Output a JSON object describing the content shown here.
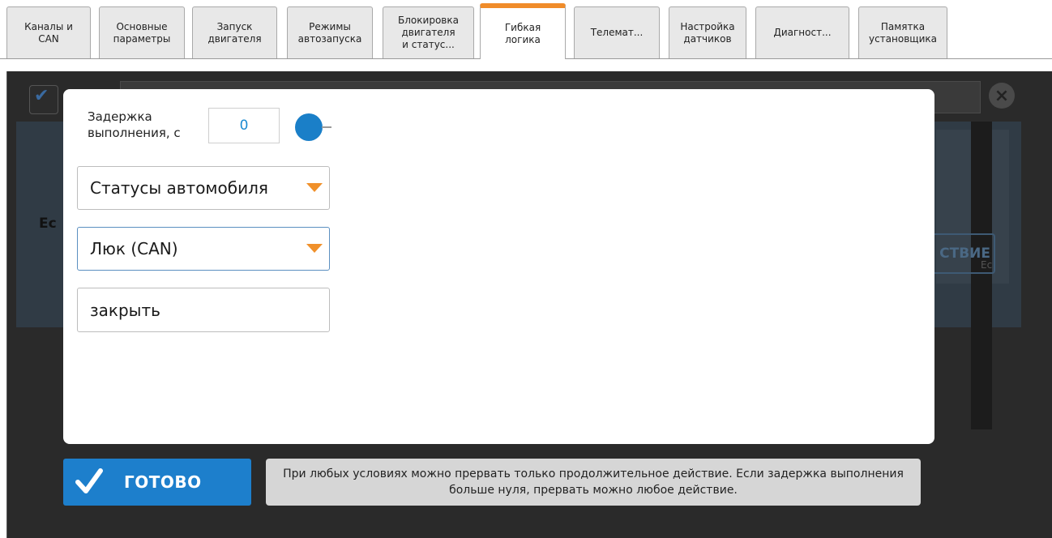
{
  "tabs": [
    {
      "label": "Каналы и\nCAN"
    },
    {
      "label": "Основные\nпараметры"
    },
    {
      "label": "Запуск\nдвигателя"
    },
    {
      "label": "Режимы\nавтозапуска"
    },
    {
      "label": "Блокировка\nдвигателя\nи статус..."
    },
    {
      "label": "Гибкая\nлогика"
    },
    {
      "label": "Телемат..."
    },
    {
      "label": "Настройка\nдатчиков"
    },
    {
      "label": "Диагност..."
    },
    {
      "label": "Памятка\nустановщика"
    }
  ],
  "active_tab_index": 5,
  "background": {
    "if_label": "Ес",
    "action_button": "СТВИЕ",
    "if_label_small": "Ес"
  },
  "modal": {
    "delay_label": "Задержка\nвыполнения, с",
    "delay_value": "0",
    "category_select": "Статусы автомобиля",
    "item_select": "Люк (CAN)",
    "action_value": "закрыть"
  },
  "footer": {
    "done_label": "ГОТОВО",
    "hint": "При любых условиях можно прервать только продолжительное действие. Если задержка выполнения больше нуля, прервать можно любое действие."
  },
  "colors": {
    "accent_orange": "#f08c2a",
    "primary_blue": "#1d7fcc",
    "value_blue": "#1b8ad1"
  }
}
